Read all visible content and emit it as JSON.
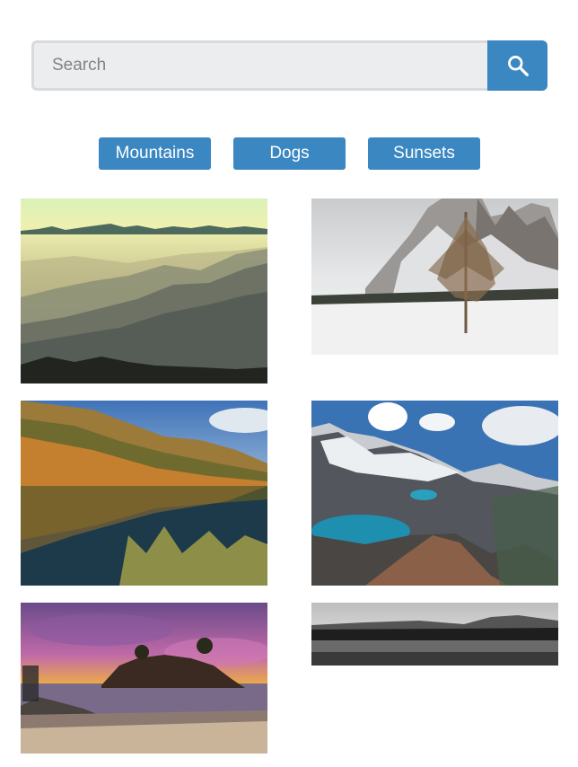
{
  "search": {
    "placeholder": "Search",
    "value": "",
    "button_icon": "search-icon"
  },
  "filters": [
    {
      "label": "Mountains"
    },
    {
      "label": "Dogs"
    },
    {
      "label": "Sunsets"
    }
  ],
  "photos": [
    {
      "subject": "misty mountain ridges at dawn"
    },
    {
      "subject": "bare larch tree in snowy mountain valley"
    },
    {
      "subject": "autumn hillside reflected in lake"
    },
    {
      "subject": "snowy peaks with turquoise glacial lakes"
    },
    {
      "subject": "rocky islet at sunset on a beach"
    },
    {
      "subject": "black and white field and distant hills"
    }
  ],
  "colors": {
    "accent": "#3a87c2",
    "input_bg": "#ecedef",
    "input_border": "#d9dadd"
  }
}
